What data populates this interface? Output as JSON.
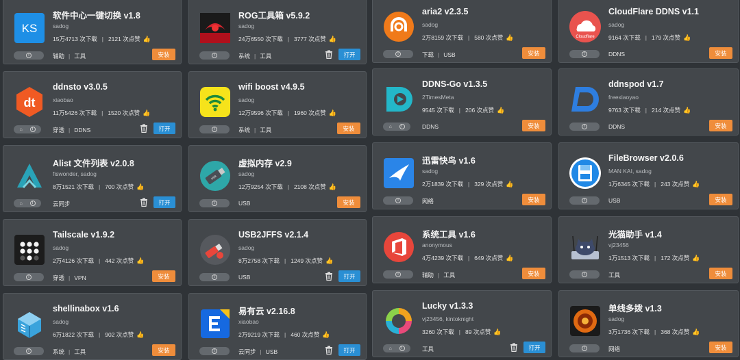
{
  "text": {
    "sep": "|"
  },
  "colors": {
    "background": "#2f3337",
    "card": "#43474b",
    "install_button": "#ef8d3b",
    "open_button": "#2a8fd4"
  },
  "apps": [
    {
      "id": "softcenter",
      "title": "软件中心一键切换 v1.8",
      "author": "sadog",
      "downloads": "15万4713 次下载",
      "likes": "2121 次点赞",
      "tags": [
        "辅助",
        "工具"
      ],
      "action": "安装",
      "action_type": "install",
      "has_trash": false,
      "has_home": false,
      "icon": "ks-icon",
      "liked": false
    },
    {
      "id": "rog",
      "title": "ROG工具箱 v5.9.2",
      "author": "sadog",
      "downloads": "24万6550 次下载",
      "likes": "3777 次点赞",
      "tags": [
        "系统",
        "工具"
      ],
      "action": "打开",
      "action_type": "open",
      "has_trash": true,
      "has_home": false,
      "icon": "rog-icon",
      "liked": false
    },
    {
      "id": "aria2",
      "title": "aria2 v2.3.5",
      "author": "sadog",
      "downloads": "2万8159 次下载",
      "likes": "580 次点赞",
      "tags": [
        "下载",
        "USB"
      ],
      "action": "安装",
      "action_type": "install",
      "has_trash": false,
      "has_home": false,
      "icon": "aria2-icon",
      "liked": false
    },
    {
      "id": "cloudflare",
      "title": "CloudFlare DDNS v1.1",
      "author": "sadog",
      "downloads": "9164 次下载",
      "likes": "179 次点赞",
      "tags": [
        "DDNS"
      ],
      "action": "安装",
      "action_type": "install",
      "has_trash": false,
      "has_home": false,
      "icon": "cloudflare-icon",
      "icon_caption": "Cloudflare",
      "liked": false
    },
    {
      "id": "ddnsto",
      "title": "ddnsto v3.0.5",
      "author": "xiaobao",
      "downloads": "11万5426 次下载",
      "likes": "1520 次点赞",
      "tags": [
        "穿透",
        "DDNS"
      ],
      "action": "打开",
      "action_type": "open",
      "has_trash": true,
      "has_home": true,
      "icon": "ddnsto-icon",
      "icon_caption": "dt",
      "liked": true
    },
    {
      "id": "wifiboost",
      "title": "wifi boost v4.9.5",
      "author": "sadog",
      "downloads": "12万9596 次下载",
      "likes": "1960 次点赞",
      "tags": [
        "系统",
        "工具"
      ],
      "action": "安装",
      "action_type": "install",
      "has_trash": false,
      "has_home": false,
      "icon": "wifi-icon",
      "liked": false
    },
    {
      "id": "ddnsgo",
      "title": "DDNS-Go v1.3.5",
      "author": "2TimesMeta",
      "downloads": "9545 次下载",
      "likes": "206 次点赞",
      "tags": [
        "DDNS"
      ],
      "action": "安装",
      "action_type": "install",
      "has_trash": false,
      "has_home": true,
      "icon": "ddnsgo-icon",
      "liked": false
    },
    {
      "id": "ddnspod",
      "title": "ddnspod v1.7",
      "author": "freexiaoyao",
      "downloads": "9763 次下载",
      "likes": "214 次点赞",
      "tags": [
        "DDNS"
      ],
      "action": "安装",
      "action_type": "install",
      "has_trash": false,
      "has_home": false,
      "icon": "ddnspod-icon",
      "liked": false
    },
    {
      "id": "alist",
      "title": "Alist 文件列表 v2.0.8",
      "author": "fiswonder, sadog",
      "downloads": "8万1521 次下载",
      "likes": "700 次点赞",
      "tags": [
        "云同步"
      ],
      "action": "打开",
      "action_type": "open",
      "has_trash": true,
      "has_home": true,
      "icon": "alist-icon",
      "liked": false
    },
    {
      "id": "swap",
      "title": "虚拟内存 v2.9",
      "author": "sadog",
      "downloads": "12万9254 次下载",
      "likes": "2108 次点赞",
      "tags": [
        "USB"
      ],
      "action": "安装",
      "action_type": "install",
      "has_trash": false,
      "has_home": false,
      "icon": "usb-drive-icon",
      "liked": false
    },
    {
      "id": "xunlei",
      "title": "迅雷快鸟 v1.6",
      "author": "sadog",
      "downloads": "2万1839 次下载",
      "likes": "329 次点赞",
      "tags": [
        "网络"
      ],
      "action": "安装",
      "action_type": "install",
      "has_trash": false,
      "has_home": false,
      "icon": "xunlei-bird-icon",
      "liked": false
    },
    {
      "id": "filebrowser",
      "title": "FileBrowser v2.0.6",
      "author": "MAN KAI, sadog",
      "downloads": "1万6345 次下载",
      "likes": "243 次点赞",
      "tags": [
        "USB"
      ],
      "action": "安装",
      "action_type": "install",
      "has_trash": false,
      "has_home": false,
      "icon": "filebrowser-icon",
      "liked": false
    },
    {
      "id": "tailscale",
      "title": "Tailscale v1.9.2",
      "author": "sadog",
      "downloads": "2万4126 次下载",
      "likes": "442 次点赞",
      "tags": [
        "穿透",
        "VPN"
      ],
      "action": "安装",
      "action_type": "install",
      "has_trash": false,
      "has_home": false,
      "icon": "tailscale-icon",
      "liked": false
    },
    {
      "id": "usb2jffs",
      "title": "USB2JFFS v2.1.4",
      "author": "sadog",
      "downloads": "8万2758 次下载",
      "likes": "1249 次点赞",
      "tags": [
        "USB"
      ],
      "action": "打开",
      "action_type": "open",
      "has_trash": true,
      "has_home": false,
      "icon": "usb2jffs-icon",
      "liked": true
    },
    {
      "id": "systool",
      "title": "系统工具 v1.6",
      "author": "anonymous",
      "downloads": "4万4239 次下载",
      "likes": "649 次点赞",
      "tags": [
        "辅助",
        "工具"
      ],
      "action": "安装",
      "action_type": "install",
      "has_trash": false,
      "has_home": false,
      "icon": "office-icon",
      "liked": false
    },
    {
      "id": "modem",
      "title": "光猫助手 v1.4",
      "author": "vj23456",
      "downloads": "1万1513 次下载",
      "likes": "172 次点赞",
      "tags": [
        "工具"
      ],
      "action": "安装",
      "action_type": "install",
      "has_trash": false,
      "has_home": false,
      "icon": "cat-router-icon",
      "liked": false
    },
    {
      "id": "shellinabox",
      "title": "shellinabox v1.6",
      "author": "sadog",
      "downloads": "6万1822 次下载",
      "likes": "902 次点赞",
      "tags": [
        "系统",
        "工具"
      ],
      "action": "安装",
      "action_type": "install",
      "has_trash": false,
      "has_home": false,
      "icon": "shellinabox-icon",
      "liked": false
    },
    {
      "id": "easycloud",
      "title": "易有云 v2.16.8",
      "author": "xiaobao",
      "downloads": "2万9219 次下载",
      "likes": "460 次点赞",
      "tags": [
        "云同步",
        "USB"
      ],
      "action": "打开",
      "action_type": "open",
      "has_trash": true,
      "has_home": false,
      "icon": "easycloud-icon",
      "liked": false
    },
    {
      "id": "lucky",
      "title": "Lucky v1.3.3",
      "author": "vj23456, kintoknight",
      "downloads": "3260 次下载",
      "likes": "89 次点赞",
      "tags": [
        "工具"
      ],
      "action": "打开",
      "action_type": "open",
      "has_trash": true,
      "has_home": true,
      "icon": "lucky-icon",
      "liked": false
    },
    {
      "id": "multidial",
      "title": "单线多拨 v1.3",
      "author": "sadog",
      "downloads": "3万1736 次下载",
      "likes": "368 次点赞",
      "tags": [
        "网络"
      ],
      "action": "安装",
      "action_type": "install",
      "has_trash": false,
      "has_home": false,
      "icon": "multidial-icon",
      "liked": false
    }
  ]
}
